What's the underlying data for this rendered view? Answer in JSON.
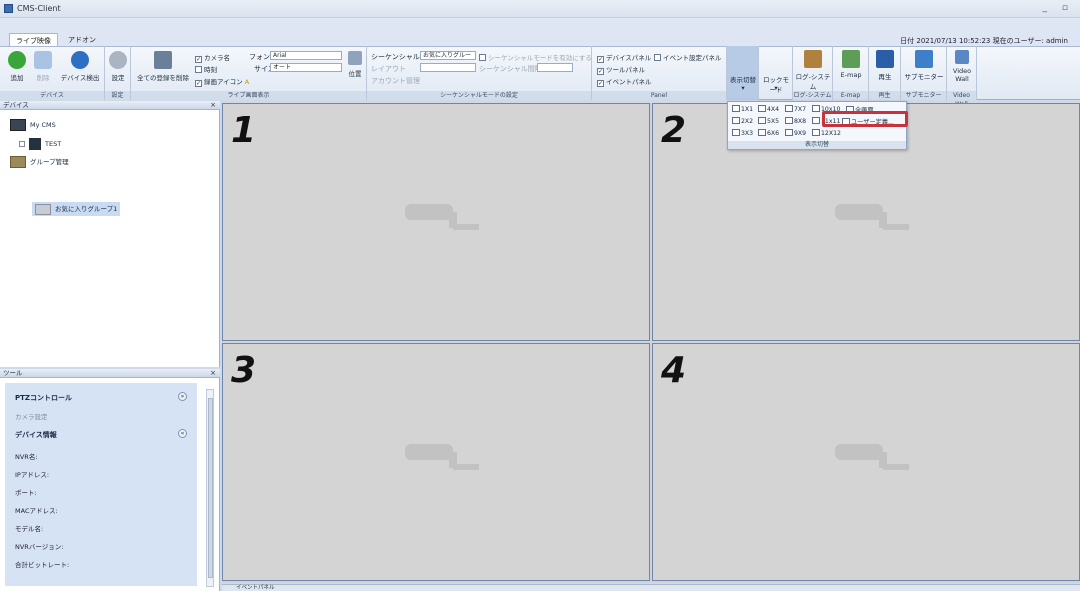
{
  "window": {
    "title": "CMS-Client",
    "controls": "_ ▫"
  },
  "tabs": [
    {
      "label": "ライブ映像"
    },
    {
      "label": "アドオン"
    }
  ],
  "status": "日付 2021/07/13 10:52:23   現在のユーザー: admin",
  "ribbon": {
    "device": {
      "caption": "デバイス",
      "add": "追加",
      "delete": "削除",
      "detect": "デバイス検出"
    },
    "setting": {
      "caption": "設定",
      "label": "設定"
    },
    "live_display": {
      "caption": "ライブ画面表示",
      "clear_all": "全ての登録を削除",
      "camera_name": "カメラ名",
      "time": "時刻",
      "rec_icon": "録画アイコン",
      "font_label": "フォント",
      "font_value": "Arial",
      "size_label": "サイズ",
      "size_value": "オート",
      "position": "位置"
    },
    "sequence": {
      "caption": "シーケンシャルモードの設定",
      "seq_label": "シーケンシャル",
      "seq_value": "お気に入りグルー",
      "seq_toggle": "シーケンシャルモードを有効にする",
      "layout_label": "レイアウト",
      "interval_label": "シーケンシャル間隔",
      "account": "アカウント管理"
    },
    "panel": {
      "caption": "Panel",
      "device_panel": "デバイスパネル",
      "event_setting_panel": "イベント設定パネル",
      "tool_panel": "ツールパネル",
      "event_panel": "イベントパネル"
    },
    "right_buttons": [
      {
        "label": "表示切替",
        "caption": ""
      },
      {
        "label": "ロックモード",
        "caption": ""
      },
      {
        "label": "ログ-システム",
        "caption": "ログ-システム"
      },
      {
        "label": "E-map",
        "caption": "E-map"
      },
      {
        "label": "再生",
        "caption": "再生"
      },
      {
        "label": "サブモニター",
        "caption": "サブモニター"
      },
      {
        "label": "Video Wall",
        "caption": "Video Wall"
      }
    ]
  },
  "layout_popup": {
    "row1": [
      "1X1",
      "4X4",
      "7X7",
      "10x10",
      "全画面"
    ],
    "row2": [
      "2X2",
      "5X5",
      "8X8",
      "11x11",
      "ユーザー定義..."
    ],
    "row3": [
      "3X3",
      "6X6",
      "9X9",
      "12X12"
    ],
    "caption": "表示切替"
  },
  "device_panel": {
    "title": "デバイス",
    "tree": [
      "My CMS",
      "TEST",
      "グループ管理",
      "お気に入りグループ1"
    ]
  },
  "tool_panel": {
    "title": "ツール",
    "ptz": "PTZコントロール",
    "camera_setting": "カメラ設定",
    "device_info": "デバイス情報",
    "fields": [
      "NVR名:",
      "IPアドレス:",
      "ポート:",
      "MACアドレス:",
      "モデル名:",
      "NVRバージョン:",
      "合計ビットレート:"
    ]
  },
  "grid": {
    "cells": [
      "1",
      "2",
      "3",
      "4"
    ]
  },
  "event_panel": "イベントパネル",
  "colors": {
    "highlight": "#c8323a",
    "grid_border": "#6e86ad",
    "ribbon": "#e1e9f4"
  }
}
